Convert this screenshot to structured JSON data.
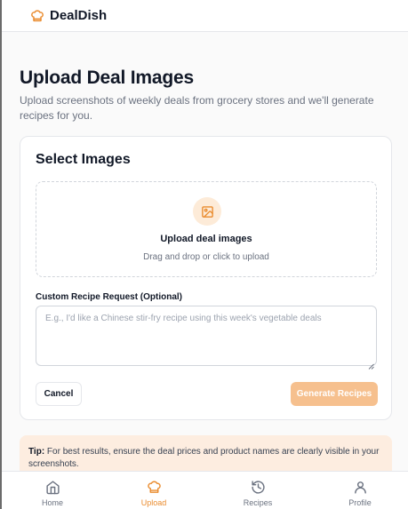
{
  "app": {
    "name": "DealDish"
  },
  "page": {
    "title": "Upload Deal Images",
    "subtitle": "Upload screenshots of weekly deals from grocery stores and we'll generate recipes for you."
  },
  "card": {
    "title": "Select Images",
    "dropzone": {
      "icon": "image-icon",
      "title": "Upload deal images",
      "subtitle": "Drag and drop or click to upload"
    },
    "field_label": "Custom Recipe Request (Optional)",
    "textarea_placeholder": "E.g., I'd like a Chinese stir-fry recipe using this week's vegetable deals",
    "cancel_label": "Cancel",
    "generate_label": "Generate Recipes"
  },
  "tip": {
    "label": "Tip:",
    "text": " For best results, ensure the deal prices and product names are clearly visible in your screenshots."
  },
  "nav": [
    {
      "label": "Home",
      "icon": "home-icon",
      "active": false
    },
    {
      "label": "Upload",
      "icon": "chef-hat-icon",
      "active": true
    },
    {
      "label": "Recipes",
      "icon": "history-icon",
      "active": false
    },
    {
      "label": "Profile",
      "icon": "user-icon",
      "active": false
    }
  ],
  "colors": {
    "accent": "#ea8c2f",
    "accent_soft": "#f6c08e",
    "tip_bg": "#fdede0"
  }
}
